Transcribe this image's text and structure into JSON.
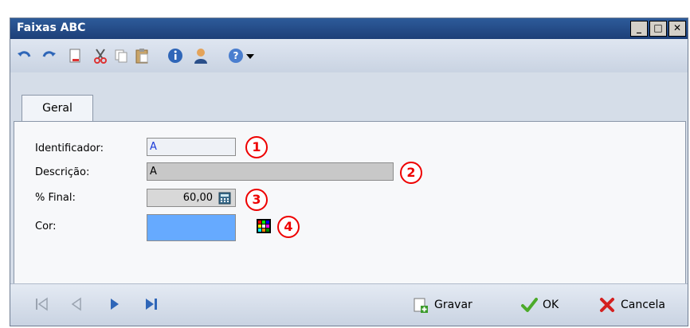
{
  "window": {
    "title": "Faixas ABC",
    "controls": [
      "minimize",
      "maximize",
      "close"
    ]
  },
  "toolbar": {
    "icons": [
      "undo-icon",
      "redo-icon",
      "new-document-icon",
      "cut-icon",
      "copy-icon",
      "paste-icon",
      "info-icon",
      "user-icon",
      "help-icon",
      "dropdown-arrow-icon"
    ]
  },
  "tabs": [
    {
      "label": "Geral",
      "selected": true
    }
  ],
  "form": {
    "identificador": {
      "label": "Identificador:",
      "value": "A",
      "marker": "1"
    },
    "descricao": {
      "label": "Descrição:",
      "value": "A",
      "marker": "2"
    },
    "final": {
      "label": "% Final:",
      "value": "60,00",
      "marker": "3"
    },
    "cor": {
      "label": "Cor:",
      "value_color": "#66aaff",
      "marker": "4"
    }
  },
  "bottom": {
    "nav_icons": [
      "first-record-icon",
      "previous-record-icon",
      "next-record-icon",
      "last-record-icon"
    ],
    "gravar": "Gravar",
    "ok": "OK",
    "cancela": "Cancela"
  },
  "colors": {
    "title_bar": "#1d3f78",
    "panel": "#f7f8fa",
    "marker": "#ee0000"
  }
}
